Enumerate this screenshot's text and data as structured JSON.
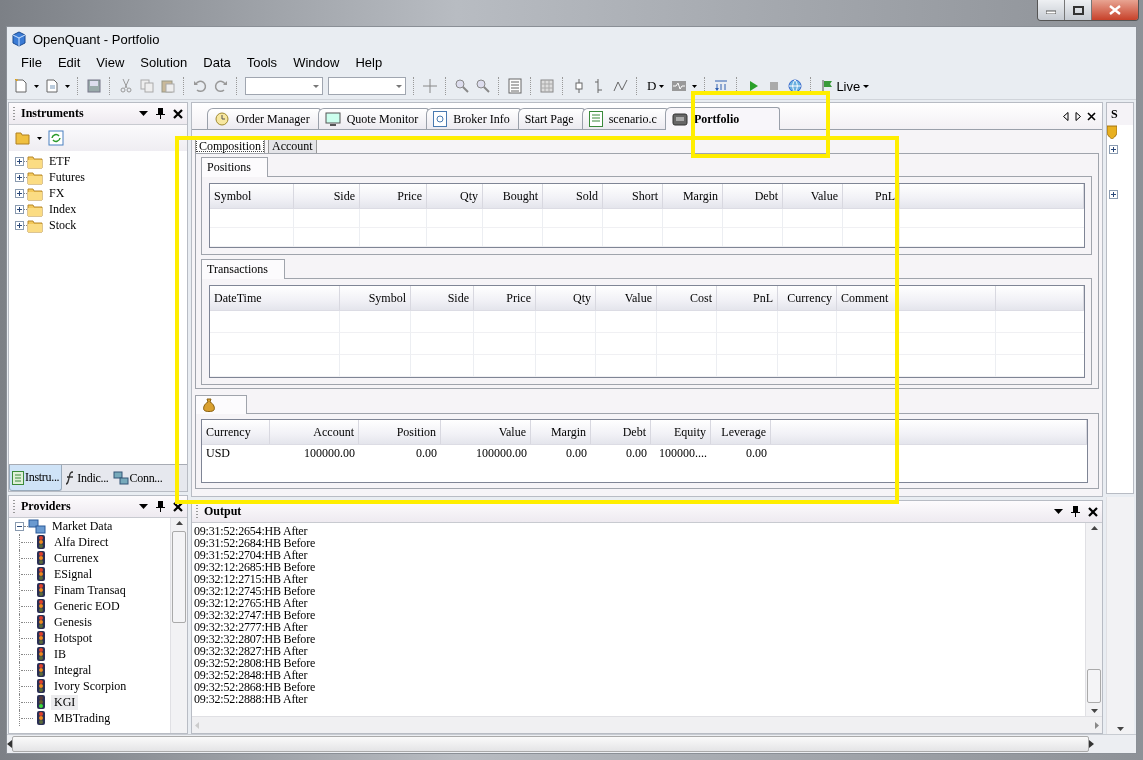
{
  "window": {
    "title": "OpenQuant - Portfolio"
  },
  "menu": [
    "File",
    "Edit",
    "View",
    "Solution",
    "Data",
    "Tools",
    "Window",
    "Help"
  ],
  "toolbar": {
    "font_button": "D",
    "live_button": "Live"
  },
  "instruments": {
    "title": "Instruments",
    "tree": [
      {
        "label": "ETF",
        "expanded": false
      },
      {
        "label": "Futures",
        "expanded": false
      },
      {
        "label": "FX",
        "expanded": false
      },
      {
        "label": "Index",
        "expanded": false
      },
      {
        "label": "Stock",
        "expanded": false
      }
    ],
    "tabs": [
      {
        "label": "Instru...",
        "selected": true
      },
      {
        "label": "Indic...",
        "selected": false
      },
      {
        "label": "Conn...",
        "selected": false
      }
    ]
  },
  "providers": {
    "title": "Providers",
    "tree": [
      {
        "label": "Market Data",
        "expanded": true,
        "children": [
          {
            "label": "Alfa Direct",
            "connected": false,
            "selected": false
          },
          {
            "label": "Currenex",
            "connected": false,
            "selected": false
          },
          {
            "label": "ESignal",
            "connected": false,
            "selected": false
          },
          {
            "label": "Finam Transaq",
            "connected": false,
            "selected": false
          },
          {
            "label": "Generic EOD",
            "connected": false,
            "selected": false
          },
          {
            "label": "Genesis",
            "connected": false,
            "selected": false
          },
          {
            "label": "Hotspot",
            "connected": false,
            "selected": false
          },
          {
            "label": "IB",
            "connected": false,
            "selected": false
          },
          {
            "label": "Integral",
            "connected": false,
            "selected": false
          },
          {
            "label": "Ivory Scorpion",
            "connected": false,
            "selected": false
          },
          {
            "label": "KGI",
            "connected": true,
            "selected": true
          },
          {
            "label": "MBTrading",
            "connected": false,
            "selected": false
          }
        ]
      }
    ]
  },
  "document_tabs": [
    {
      "label": "Order Manager",
      "selected": false
    },
    {
      "label": "Quote Monitor",
      "selected": false
    },
    {
      "label": "Broker Info",
      "selected": false
    },
    {
      "label": "Start Page",
      "selected": false
    },
    {
      "label": "scenario.c",
      "selected": false
    },
    {
      "label": "Portfolio",
      "selected": true
    }
  ],
  "portfolio": {
    "tabs": [
      {
        "label": "Composition",
        "selected": true
      },
      {
        "label": "Account",
        "selected": false
      }
    ],
    "positions": {
      "title": "Positions",
      "columns": [
        "Symbol",
        "Side",
        "Price",
        "Qty",
        "Bought",
        "Sold",
        "Short",
        "Margin",
        "Debt",
        "Value",
        "PnL"
      ]
    },
    "transactions": {
      "title": "Transactions",
      "columns": [
        "DateTime",
        "Symbol",
        "Side",
        "Price",
        "Qty",
        "Value",
        "Cost",
        "PnL",
        "Currency",
        "Comment"
      ]
    },
    "account": {
      "columns": [
        "Currency",
        "Account",
        "Position",
        "Value",
        "Margin",
        "Debt",
        "Equity",
        "Leverage"
      ],
      "rows": [
        [
          "USD",
          "100000.00",
          "0.00",
          "100000.00",
          "0.00",
          "0.00",
          "100000....",
          "0.00"
        ]
      ]
    }
  },
  "output": {
    "title": "Output",
    "lines": [
      "09:31:52:2654:HB After",
      "09:31:52:2684:HB Before",
      "09:31:52:2704:HB After",
      "09:32:12:2685:HB Before",
      "09:32:12:2715:HB After",
      "09:32:12:2745:HB Before",
      "09:32:12:2765:HB After",
      "09:32:32:2747:HB Before",
      "09:32:32:2777:HB After",
      "09:32:32:2807:HB Before",
      "09:32:32:2827:HB After",
      "09:32:52:2808:HB Before",
      "09:32:52:2848:HB After",
      "09:32:52:2868:HB Before",
      "09:32:52:2888:HB After"
    ]
  },
  "right_panel": {
    "title": "S"
  }
}
